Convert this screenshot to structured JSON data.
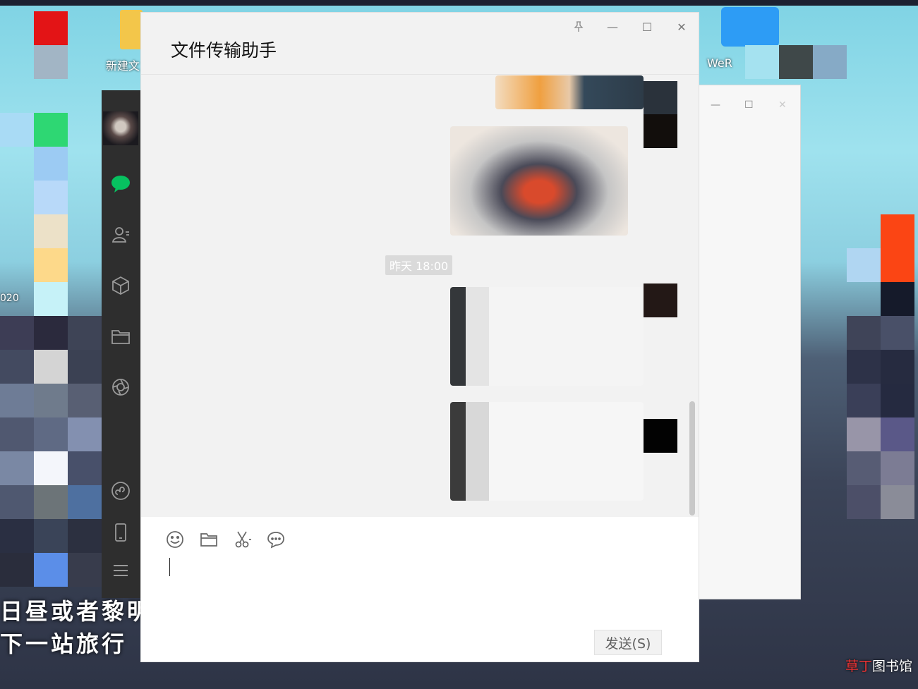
{
  "desktop": {
    "icon_labels": [
      "新建文",
      "WeR",
      "020"
    ],
    "bottom_lines": [
      "日昼或者黎明",
      "下一站旅行"
    ],
    "watermark_accent": "草丁",
    "watermark_rest": "图书馆"
  },
  "sidebar": {
    "items": [
      {
        "name": "chat-icon"
      },
      {
        "name": "contacts-icon"
      },
      {
        "name": "favorites-icon"
      },
      {
        "name": "files-icon"
      },
      {
        "name": "moments-icon"
      },
      {
        "name": "miniprogram-icon"
      },
      {
        "name": "phone-icon"
      },
      {
        "name": "menu-icon"
      }
    ]
  },
  "chat": {
    "title": "文件传输助手",
    "window_controls": [
      "pin",
      "minimize",
      "maximize",
      "close"
    ],
    "timestamp": "昨天 18:00",
    "toolbar": [
      "emoji-icon",
      "folder-icon",
      "scissors-icon",
      "chat-bubble-icon"
    ],
    "send_label": "发送(S)"
  },
  "colors": {
    "sidebar_bg": "#2e2e2e",
    "chat_bg": "#f2f2f2",
    "accent_green": "#07c160"
  }
}
